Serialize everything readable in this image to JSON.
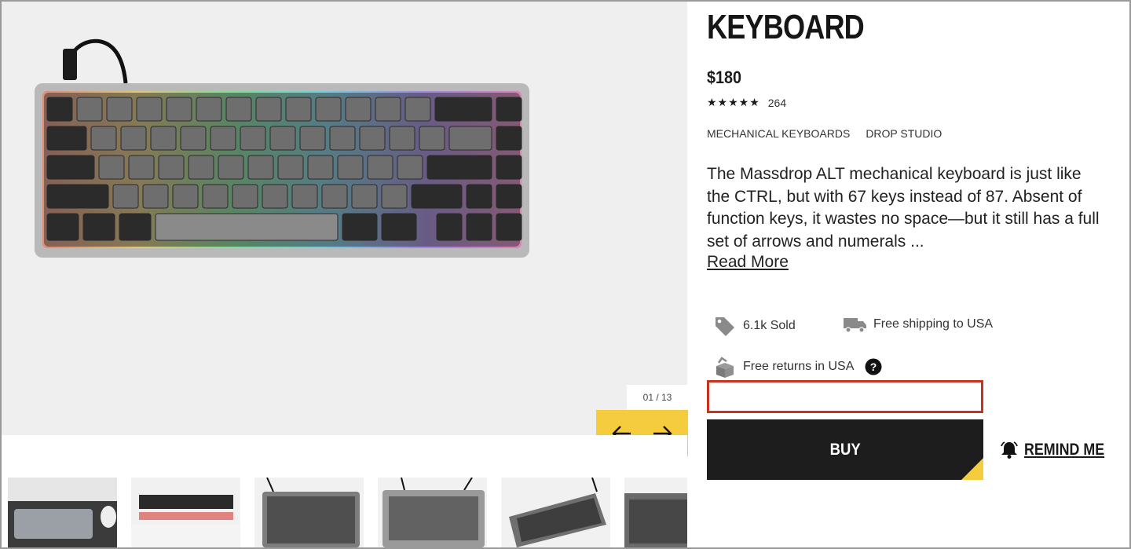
{
  "product": {
    "title": "KEYBOARD",
    "price": "$180",
    "stars": "★★★★★",
    "review_count": "264",
    "tags": [
      "MECHANICAL KEYBOARDS",
      "DROP STUDIO"
    ],
    "description": "The Massdrop ALT mechanical keyboard is just like the CTRL, but with 67 keys instead of 87. Absent of function keys, it wastes no space—but it still has a full set of arrows and numerals ...",
    "read_more": "Read More"
  },
  "perks": {
    "sold": "6.1k Sold",
    "shipping": "Free shipping to USA",
    "returns": "Free returns in USA"
  },
  "actions": {
    "buy": "BUY",
    "remind": "REMIND ME"
  },
  "gallery": {
    "counter": "01 / 13"
  },
  "colors": {
    "accent": "#f6cc3f",
    "error_border": "#c8321f",
    "buy_bg": "#1d1d1d"
  }
}
